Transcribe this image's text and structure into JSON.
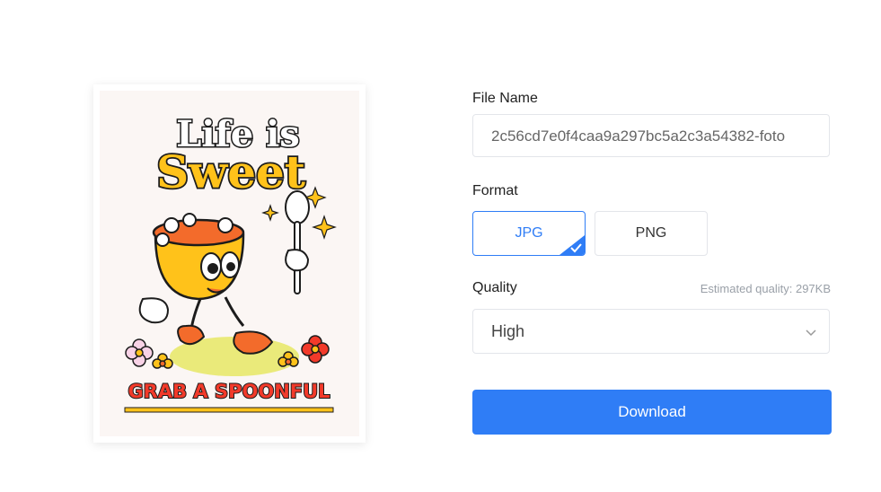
{
  "preview": {
    "poster_title_line1": "Life is",
    "poster_title_line2": "Sweet",
    "poster_tagline": "GRAB A SPOONFUL"
  },
  "form": {
    "file_name_label": "File Name",
    "file_name_value": "2c56cd7e0f4caa9a297bc5a2c3a54382-foto",
    "format_label": "Format",
    "formats": [
      {
        "label": "JPG",
        "selected": true
      },
      {
        "label": "PNG",
        "selected": false
      }
    ],
    "quality_label": "Quality",
    "estimated_quality": "Estimated quality: 297KB",
    "quality_value": "High",
    "download_label": "Download"
  },
  "colors": {
    "accent": "#2f7df6",
    "border": "#e3e5ea"
  }
}
